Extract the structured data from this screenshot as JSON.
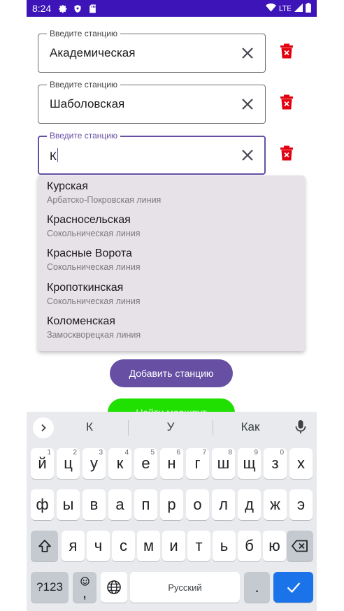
{
  "status_bar": {
    "time": "8:24",
    "network": "LTE"
  },
  "fields": [
    {
      "label": "Введите станцию",
      "value": "Академическая"
    },
    {
      "label": "Введите станцию",
      "value": "Шаболовская"
    },
    {
      "label": "Введите станцию",
      "value": "К"
    }
  ],
  "suggestions": [
    {
      "name": "Курская",
      "line": "Арбатско-Покровская линия"
    },
    {
      "name": "Красносельская",
      "line": "Сокольническая линия"
    },
    {
      "name": "Красные Ворота",
      "line": "Сокольническая линия"
    },
    {
      "name": "Кропоткинская",
      "line": "Сокольническая линия"
    },
    {
      "name": "Коломенская",
      "line": "Замоскворецкая линия"
    }
  ],
  "buttons": {
    "add": "Добавить станцию",
    "find": "Найти маршрут"
  },
  "keyboard": {
    "suggestions": [
      "К",
      "У",
      "Как"
    ],
    "row1": [
      {
        "k": "й",
        "h": "1"
      },
      {
        "k": "ц",
        "h": "2"
      },
      {
        "k": "у",
        "h": "3"
      },
      {
        "k": "к",
        "h": "4"
      },
      {
        "k": "е",
        "h": "5"
      },
      {
        "k": "н",
        "h": "6"
      },
      {
        "k": "г",
        "h": "7"
      },
      {
        "k": "ш",
        "h": "8"
      },
      {
        "k": "щ",
        "h": "9"
      },
      {
        "k": "з",
        "h": "0"
      },
      {
        "k": "х",
        "h": ""
      }
    ],
    "row2": [
      "ф",
      "ы",
      "в",
      "а",
      "п",
      "р",
      "о",
      "л",
      "д",
      "ж",
      "э"
    ],
    "row3": [
      "я",
      "ч",
      "с",
      "м",
      "и",
      "т",
      "ь",
      "б",
      "ю"
    ],
    "symbols": "?123",
    "emoji_comma": ",",
    "space": "Русский",
    "period": "."
  },
  "colors": {
    "status_bar": "#3d14b8",
    "accent": "#6750a4",
    "delete": "#e3000f",
    "find": "#1fe000",
    "enter": "#1a73e8"
  }
}
